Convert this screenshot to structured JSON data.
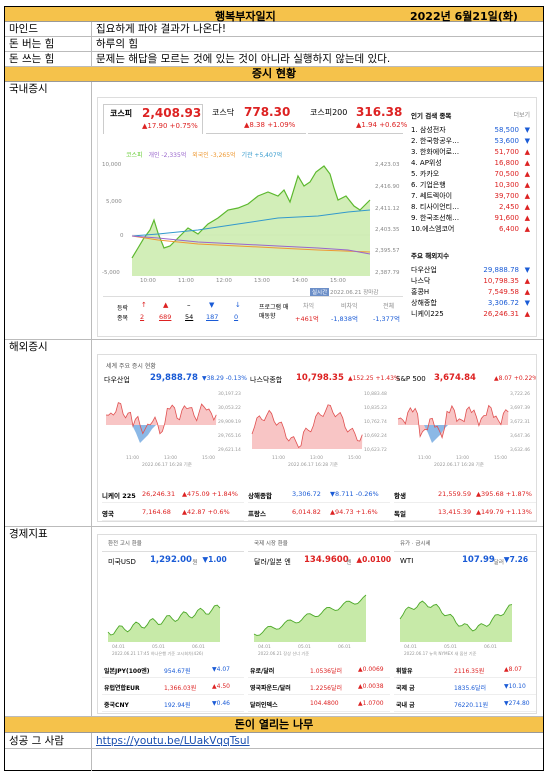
{
  "title": "행복부자일지",
  "date": "2022년 6월21일(화)",
  "rows": [
    {
      "label": "마인드",
      "value": "집요하게 파야 결과가 나온다!"
    },
    {
      "label": "돈 버는 힘",
      "value": "하루의 힘"
    },
    {
      "label": "돈 쓰는 힘",
      "value": "문제는 해답을 모르는 것에 있는 것이 아니라 실행하지 않는데 있다."
    }
  ],
  "section_market": "증시 현황",
  "domestic_label": "국내증시",
  "overseas_label": "해외증시",
  "econ_label": "경제지표",
  "section_tree": "돈이 열리는 나무",
  "success_label": "성공 그 사람",
  "success_link": "https://youtu.be/LUakVqqTsuI",
  "domestic": {
    "tabs": [
      {
        "name": "코스피",
        "value": "2,408.93",
        "change": "▲17.90 +0.75%"
      },
      {
        "name": "코스닥",
        "value": "778.30",
        "change": "▲8.38 +1.09%"
      },
      {
        "name": "코스피200",
        "value": "316.38",
        "change": "▲1.94 +0.62%"
      }
    ],
    "legend": [
      "코스피",
      "개인 -2,335억",
      "외국인 -3,265억",
      "기관 +5,407억"
    ],
    "y_left": [
      "10,000",
      "5,000",
      "0",
      "-5,000"
    ],
    "y_right": [
      "2,423.03",
      "2,416.90",
      "2,411.12",
      "2,403.35",
      "2,395.57",
      "2,387.79"
    ],
    "x_ticks": [
      "10:00",
      "11:00",
      "12:00",
      "13:00",
      "14:00",
      "15:00"
    ],
    "stamp": "실시간",
    "stamp_date": "2022.06.21 장마감",
    "stats_labels": [
      "등락",
      "종목",
      "상승",
      "상한",
      "보합",
      "하락",
      "하한"
    ],
    "stats": [
      "2",
      "689",
      "54",
      "187",
      "0"
    ],
    "trade_label": "프로그램 매매동향",
    "trade_heads": [
      "차익",
      "비차익",
      "전체"
    ],
    "trade_vals": [
      "+461억",
      "-1,838억",
      "-1,377억"
    ],
    "rank_title": "인기 검색 종목",
    "rank_more": "더보기",
    "ranks": [
      {
        "n": "1. 삼성전자",
        "v": "58,500",
        "a": "▼"
      },
      {
        "n": "2. 한국항공우…",
        "v": "53,600",
        "a": "▼"
      },
      {
        "n": "3. 한화에어로…",
        "v": "51,700",
        "a": "▲"
      },
      {
        "n": "4. AP위성",
        "v": "16,800",
        "a": "▲"
      },
      {
        "n": "5. 카카오",
        "v": "70,500",
        "a": "▲"
      },
      {
        "n": "6. 기업은행",
        "v": "10,300",
        "a": "▲"
      },
      {
        "n": "7. 쎄트렉아이",
        "v": "39,700",
        "a": "▲"
      },
      {
        "n": "8. 티사이언티…",
        "v": "2,450",
        "a": "▲"
      },
      {
        "n": "9. 한국조선해…",
        "v": "91,600",
        "a": "▲"
      },
      {
        "n": "10.에스엠코어",
        "v": "6,400",
        "a": "▲"
      }
    ],
    "world_title": "주요 해외지수",
    "world": [
      {
        "n": "다우산업",
        "v": "29,888.78",
        "a": "▼"
      },
      {
        "n": "나스닥",
        "v": "10,798.35",
        "a": "▲"
      },
      {
        "n": "홍콩H",
        "v": "7,549.58",
        "a": "▲"
      },
      {
        "n": "상해종합",
        "v": "3,306.72",
        "a": "▼"
      },
      {
        "n": "니케이225",
        "v": "26,246.31",
        "a": "▲"
      }
    ]
  },
  "overseas": {
    "header": "세계 주요 증시 현황",
    "cards": [
      {
        "name": "다우산업",
        "value": "29,888.78",
        "change": "▼38.29 -0.13%",
        "ticks": [
          "30,197.23",
          "30,053.22",
          "29,909.19",
          "29,765.16",
          "29,621.14"
        ]
      },
      {
        "name": "나스닥종합",
        "value": "10,798.35",
        "change": "▲152.25 +1.43%",
        "ticks": [
          "10,883.48",
          "10,835.23",
          "10,762.74",
          "10,692.24",
          "10,623.72"
        ]
      },
      {
        "name": "S&P 500",
        "value": "3,674.84",
        "change": "▲8.07 +0.22%",
        "ticks": [
          "3,722.26",
          "3,697.39",
          "3,672.31",
          "3,647.36",
          "3,632.46"
        ]
      }
    ],
    "x_ticks": [
      "11:00",
      "13:00",
      "15:00"
    ],
    "stamp": "2022.06.17 16:28 기준",
    "table": [
      {
        "n": "니케이 225",
        "v": "26,246.31",
        "c": "▲475.09 +1.84%"
      },
      {
        "n": "상해종합",
        "v": "3,306.72",
        "c": "▼8.711 -0.26%"
      },
      {
        "n": "항생",
        "v": "21,559.59",
        "c": "▲395.68 +1.87%"
      },
      {
        "n": "영국",
        "v": "7,164.68",
        "c": "▲42.87 +0.6%"
      },
      {
        "n": "프랑스",
        "v": "6,014.82",
        "c": "▲94.73 +1.6%"
      },
      {
        "n": "독일",
        "v": "13,415.39",
        "c": "▲149.79 +1.13%"
      }
    ]
  },
  "econ": {
    "heads": [
      "환전 고시 환율",
      "국제 시장 환율",
      "유가 · 금시세"
    ],
    "cards": [
      {
        "name": "미국USD",
        "value": "1,292.00",
        "unit": "원",
        "change": "▼1.00",
        "stamp": "2022.06.21 17:45 하나은행 기준 고시회차(426)"
      },
      {
        "name": "달러/일본 엔",
        "value": "134.9600",
        "unit": "엔",
        "change": "▲0.0100",
        "stamp": "2022.06.21 장상 신너 기준"
      },
      {
        "name": "WTI",
        "value": "107.99",
        "unit": "달러",
        "change": "▼7.26",
        "stamp": "2022.06.17 뉴욕 NYMEX 새 옵션 기준"
      }
    ],
    "x_ticks": [
      "04.01",
      "05.01",
      "06.01"
    ],
    "table": [
      {
        "n": "일본JPY(100엔)",
        "v": "954.67원",
        "c": "▼4.07"
      },
      {
        "n": "유로/달러",
        "v": "1.0536달러",
        "c": "▲0.0069"
      },
      {
        "n": "휘발유",
        "v": "2116.35원",
        "c": "▲8.07"
      },
      {
        "n": "유럽연합EUR",
        "v": "1,366.03원",
        "c": "▲4.50"
      },
      {
        "n": "영국파운드/달러",
        "v": "1.2256달러",
        "c": "▲0.0038"
      },
      {
        "n": "국제 금",
        "v": "1835.6달러",
        "c": "▼10.10"
      },
      {
        "n": "중국CNY",
        "v": "192.94원",
        "c": "▼0.46"
      },
      {
        "n": "달러인덱스",
        "v": "104.4800",
        "c": "▲1.0700"
      },
      {
        "n": "국내 금",
        "v": "76220.11원",
        "c": "▼274.80"
      }
    ]
  }
}
